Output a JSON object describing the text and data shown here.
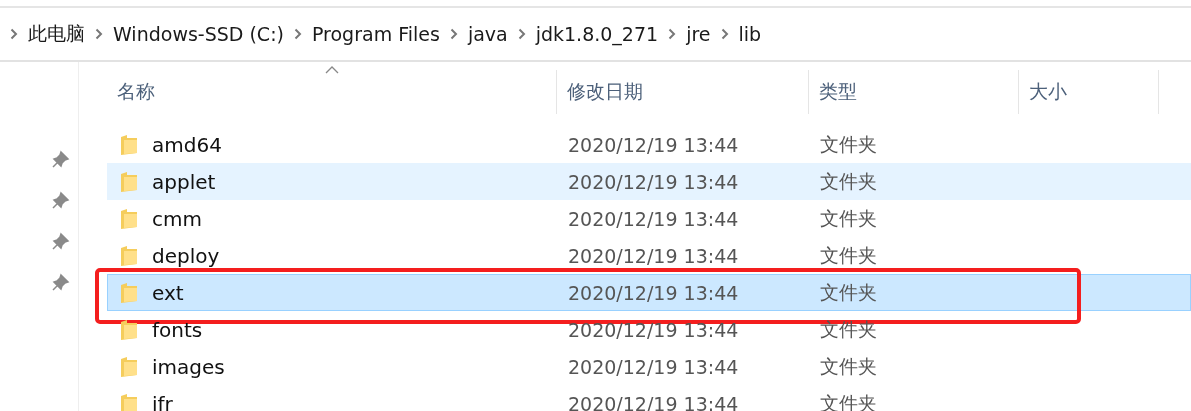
{
  "breadcrumb": [
    "此电脑",
    "Windows-SSD (C:)",
    "Program Files",
    "java",
    "jdk1.8.0_271",
    "jre",
    "lib"
  ],
  "columns": [
    {
      "label": "名称",
      "sorted": true
    },
    {
      "label": "修改日期",
      "sorted": false
    },
    {
      "label": "类型",
      "sorted": false
    },
    {
      "label": "大小",
      "sorted": false
    }
  ],
  "rows": [
    {
      "name": "amd64",
      "modified": "2020/12/19 13:44",
      "type": "文件夹",
      "selected": false,
      "hovered": false,
      "outlined": false
    },
    {
      "name": "applet",
      "modified": "2020/12/19 13:44",
      "type": "文件夹",
      "selected": false,
      "hovered": true,
      "outlined": false
    },
    {
      "name": "cmm",
      "modified": "2020/12/19 13:44",
      "type": "文件夹",
      "selected": false,
      "hovered": false,
      "outlined": false
    },
    {
      "name": "deploy",
      "modified": "2020/12/19 13:44",
      "type": "文件夹",
      "selected": false,
      "hovered": false,
      "outlined": false
    },
    {
      "name": "ext",
      "modified": "2020/12/19 13:44",
      "type": "文件夹",
      "selected": true,
      "hovered": false,
      "outlined": true
    },
    {
      "name": "fonts",
      "modified": "2020/12/19 13:44",
      "type": "文件夹",
      "selected": false,
      "hovered": false,
      "outlined": false
    },
    {
      "name": "images",
      "modified": "2020/12/19 13:44",
      "type": "文件夹",
      "selected": false,
      "hovered": false,
      "outlined": false
    },
    {
      "name": "ifr",
      "modified": "2020/12/19 13:44",
      "type": "文件夹",
      "selected": false,
      "hovered": false,
      "outlined": false
    }
  ]
}
